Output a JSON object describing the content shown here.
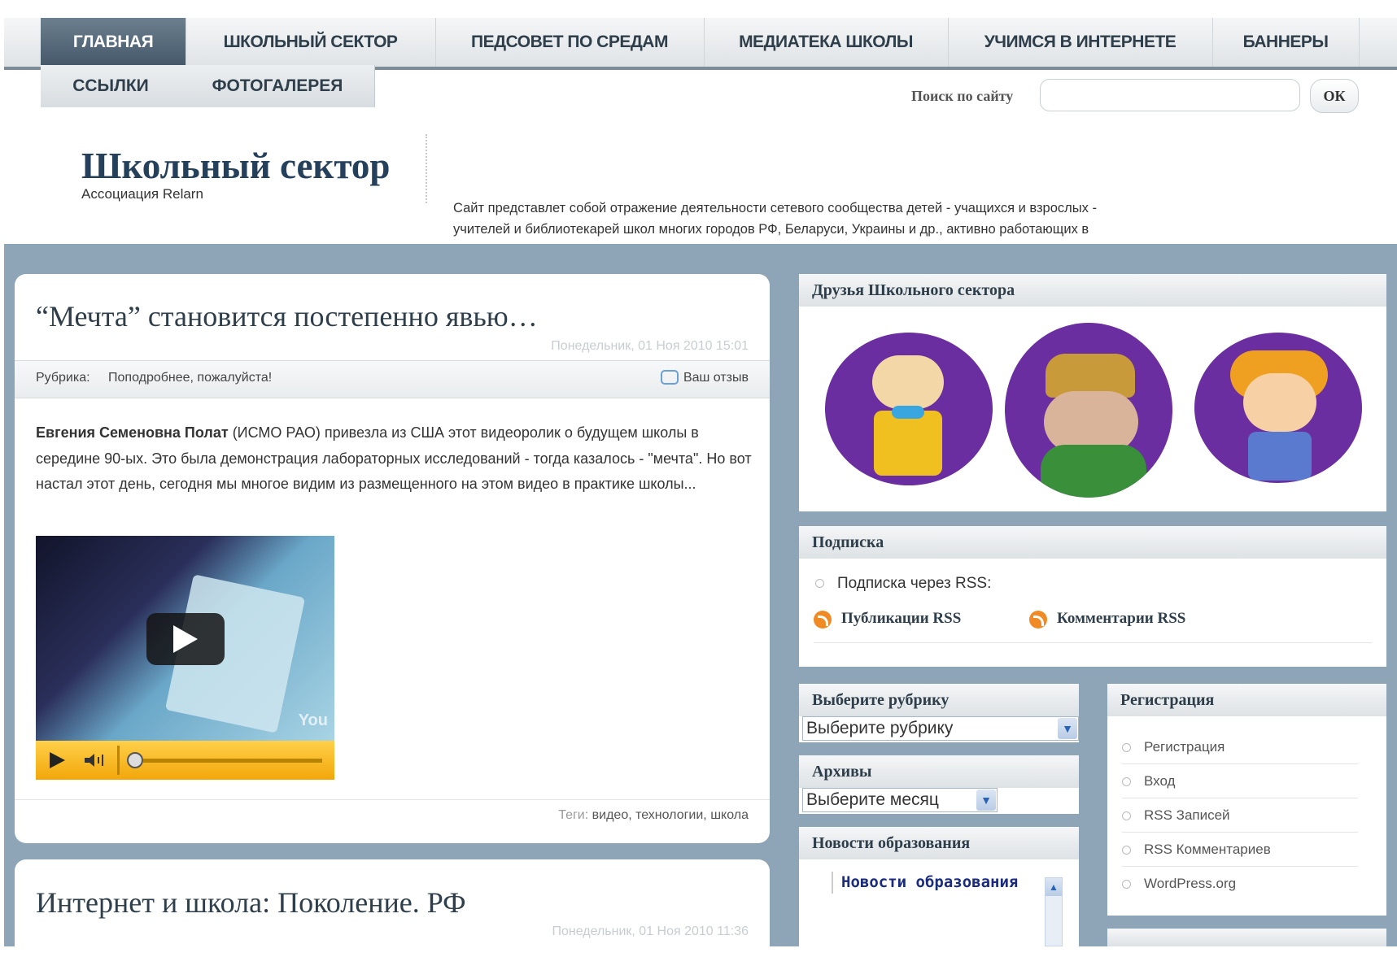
{
  "nav": {
    "tabs": [
      {
        "label": "ГЛАВНАЯ"
      },
      {
        "label": "ШКОЛЬНЫЙ СЕКТОР"
      },
      {
        "label": "ПЕДСОВЕТ ПО СРЕДАМ"
      },
      {
        "label": "МЕДИАТЕКА ШКОЛЫ"
      },
      {
        "label": "УЧИМСЯ В ИНТЕРНЕТЕ"
      },
      {
        "label": "БАННЕРЫ"
      }
    ],
    "subtabs": [
      {
        "label": "ССЫЛКИ"
      },
      {
        "label": "ФОТОГАЛЕРЕЯ"
      }
    ]
  },
  "search": {
    "label": "Поиск по сайту",
    "value": "",
    "button": "ОК"
  },
  "header": {
    "title": "Школьный сектор",
    "subtitle": "Ассоциация Relarn",
    "description": "Сайт представлет собой отражение деятельности сетевого сообщества детей - учащихся и взрослых - учителей и библиотекарей школ многих городов РФ, Беларуси, Украины и др., активно работающих в Интернет в сетевых проектах и конкурсах."
  },
  "post1": {
    "title": "“Мечта” становится постепенно явью…",
    "date": "Понедельник, 01 Ноя 2010 15:01",
    "category_label": "Рубрика:",
    "category": "Поподробнее, пожалуйста!",
    "comment": "Ваш отзыв",
    "author": "Евгения Семеновна Полат",
    "body": " (ИСМО РАО) привезла из США этот видеоролик о будущем школы в середине 90-ых. Это была демонстрация лабораторных исследований - тогда казалось - \"мечта\". Но вот настал этот день, сегодня мы многое видим из размещенного на этом видео в практике школы...",
    "video_logo": "You",
    "tags_label": "Теги:",
    "tags": "видео, технологии, школа"
  },
  "post2": {
    "title": "Интернет и школа: Поколение. РФ",
    "date": "Понедельник, 01 Ноя 2010 11:36"
  },
  "sidebar": {
    "friends": {
      "title": "Друзья Школьного сектора"
    },
    "subscribe": {
      "title": "Подписка",
      "rss_label": "Подписка через RSS:",
      "posts_rss": "Публикации RSS",
      "comments_rss": "Комментарии RSS"
    },
    "categories": {
      "title": "Выберите рубрику",
      "selected": "Выберите рубрику"
    },
    "archives": {
      "title": "Архивы",
      "selected": "Выберите месяц"
    },
    "news": {
      "title": "Новости образования",
      "inner": "Новости образования"
    },
    "registration": {
      "title": "Регистрация",
      "items": [
        {
          "label": "Регистрация"
        },
        {
          "label": "Вход"
        },
        {
          "label": "RSS Записей"
        },
        {
          "label": "RSS Комментариев"
        },
        {
          "label": "WordPress.org"
        }
      ]
    }
  },
  "colors": {
    "nav_active": "#4f6375",
    "page_bg": "#8ea5b7",
    "title": "#24405a",
    "rss": "#f08a24",
    "avatar_bg": "#6a2ea0"
  }
}
